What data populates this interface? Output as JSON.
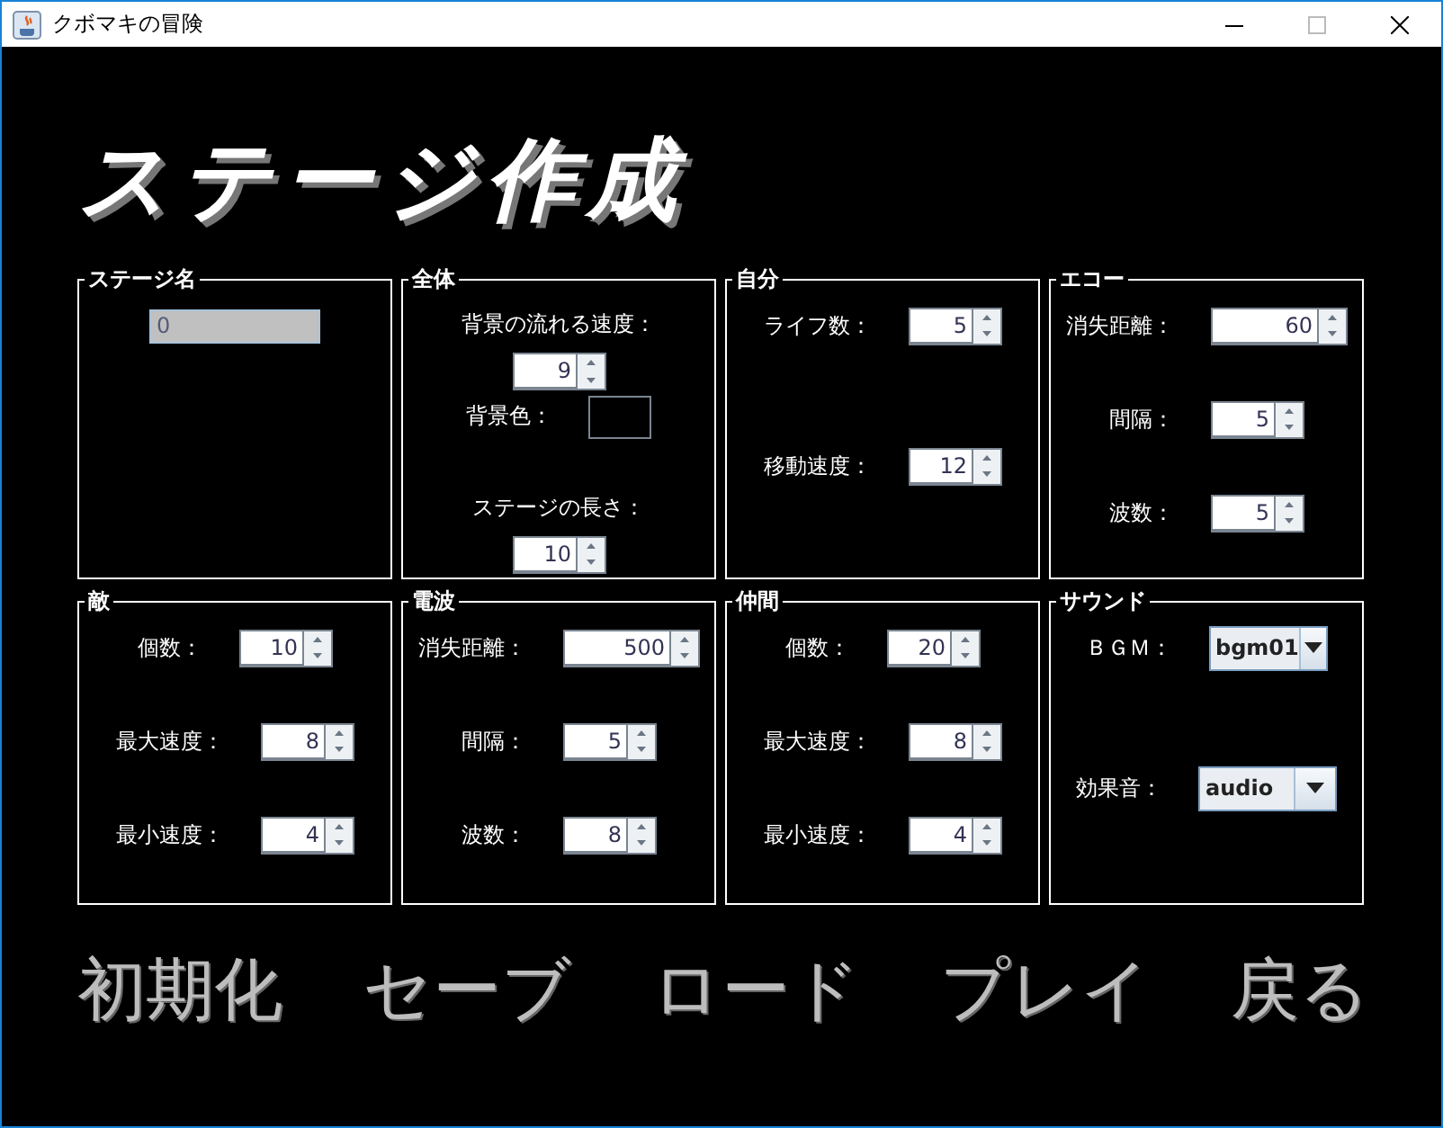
{
  "window": {
    "title": "クボマキの冒険"
  },
  "heading": "ステージ作成",
  "panels": [
    {
      "title": "ステージ名",
      "rows": [
        [
          {
            "kind": "text",
            "value": "0"
          }
        ]
      ]
    },
    {
      "title": "全体",
      "rows": [
        [
          {
            "kind": "label",
            "text": "背景の流れる速度："
          }
        ],
        [
          {
            "kind": "spinner",
            "value": "9"
          }
        ],
        [
          {
            "kind": "label",
            "text": "背景色："
          },
          {
            "kind": "swatch",
            "color": "#000000"
          }
        ],
        [
          {
            "kind": "label",
            "text": "ステージの長さ："
          }
        ],
        [
          {
            "kind": "spinner",
            "value": "10"
          }
        ]
      ]
    },
    {
      "title": "自分",
      "rows": [
        [
          {
            "kind": "label",
            "text": "ライフ数："
          },
          {
            "kind": "spinner",
            "value": "5"
          }
        ],
        [
          {
            "kind": "label",
            "text": "移動速度："
          },
          {
            "kind": "spinner",
            "value": "12"
          }
        ]
      ]
    },
    {
      "title": "エコー",
      "rows": [
        [
          {
            "kind": "label",
            "text": "消失距離："
          },
          {
            "kind": "spinner",
            "value": "60"
          }
        ],
        [
          {
            "kind": "label",
            "text": "間隔："
          },
          {
            "kind": "spinner",
            "value": "5"
          }
        ],
        [
          {
            "kind": "label",
            "text": "波数："
          },
          {
            "kind": "spinner",
            "value": "5"
          }
        ]
      ]
    },
    {
      "title": "敵",
      "rows": [
        [
          {
            "kind": "label",
            "text": "個数："
          },
          {
            "kind": "spinner",
            "value": "10"
          }
        ],
        [
          {
            "kind": "label",
            "text": "最大速度："
          },
          {
            "kind": "spinner",
            "value": "8"
          }
        ],
        [
          {
            "kind": "label",
            "text": "最小速度："
          },
          {
            "kind": "spinner",
            "value": "4"
          }
        ]
      ]
    },
    {
      "title": "電波",
      "rows": [
        [
          {
            "kind": "label",
            "text": "消失距離："
          },
          {
            "kind": "spinner",
            "value": "500"
          }
        ],
        [
          {
            "kind": "label",
            "text": "間隔："
          },
          {
            "kind": "spinner",
            "value": "5"
          }
        ],
        [
          {
            "kind": "label",
            "text": "波数："
          },
          {
            "kind": "spinner",
            "value": "8"
          }
        ]
      ]
    },
    {
      "title": "仲間",
      "rows": [
        [
          {
            "kind": "label",
            "text": "個数："
          },
          {
            "kind": "spinner",
            "value": "20"
          }
        ],
        [
          {
            "kind": "label",
            "text": "最大速度："
          },
          {
            "kind": "spinner",
            "value": "8"
          }
        ],
        [
          {
            "kind": "label",
            "text": "最小速度："
          },
          {
            "kind": "spinner",
            "value": "4"
          }
        ]
      ]
    },
    {
      "title": "サウンド",
      "rows": [
        [
          {
            "kind": "label",
            "text": "ＢＧＭ："
          },
          {
            "kind": "combo",
            "value": "bgm01"
          }
        ],
        [
          {
            "kind": "label",
            "text": "効果音："
          },
          {
            "kind": "combo",
            "value": "audio"
          }
        ]
      ]
    }
  ],
  "buttons": [
    "初期化",
    "セーブ",
    "ロード",
    "プレイ",
    "戻る"
  ]
}
